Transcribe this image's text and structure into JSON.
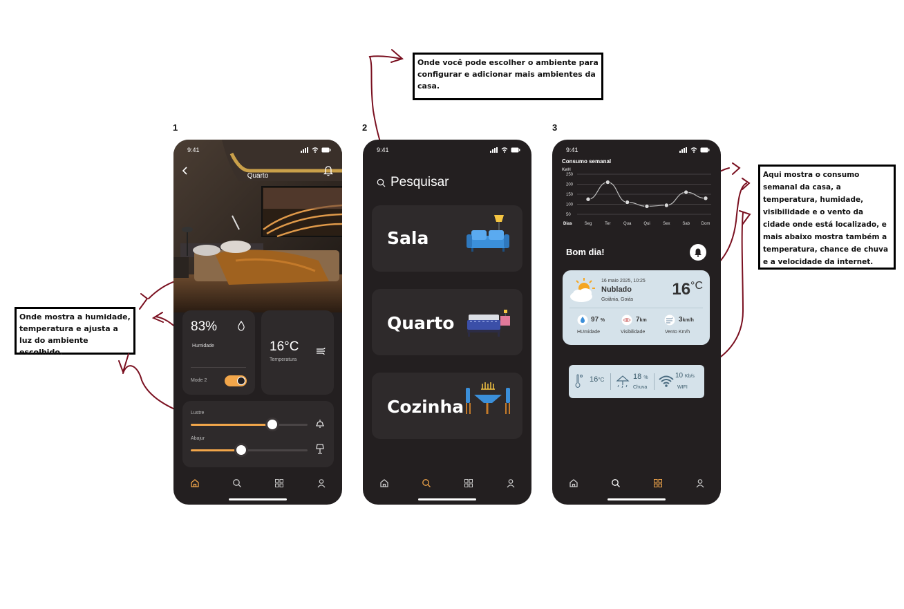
{
  "labels": {
    "p1": "1",
    "p2": "2",
    "p3": "3"
  },
  "notes": {
    "top": "Onde você pode escolher o ambiente para configurar e adicionar mais ambientes da casa.",
    "left": "Onde mostra a humidade, temperatura e ajusta a luz do ambiente escolhido.",
    "right": "Aqui mostra o consumo semanal da casa, a temperatura, humidade, visibilidade e o vento da cidade onde está localizado, e mais abaixo mostra também a temperatura, chance de chuva e a velocidade da internet."
  },
  "status": {
    "time": "9:41"
  },
  "screen1": {
    "title": "Quarto",
    "humidity": {
      "value": "83%",
      "label": "Humidade"
    },
    "temperature": {
      "value": "16°C",
      "label": "Temperatura"
    },
    "mode": {
      "label": "Mode 2",
      "on": true
    },
    "sliders": [
      {
        "label": "Lustre",
        "level": 0.7
      },
      {
        "label": "Abajur",
        "level": 0.43
      }
    ],
    "accent": "#f2a64a"
  },
  "screen2": {
    "search_placeholder": "Pesquisar",
    "rooms": [
      {
        "name": "Sala",
        "icon": "sofa-icon"
      },
      {
        "name": "Quarto",
        "icon": "bed-icon"
      },
      {
        "name": "Cozinha",
        "icon": "dining-table-icon"
      }
    ]
  },
  "screen3": {
    "chart_title": "Consumo semanal",
    "greeting": "Bom dia!",
    "weather": {
      "datetime": "16 maio 2025, 10:25",
      "condition": "Nublado",
      "location": "Goiânia, Goiás",
      "temp": "16",
      "temp_unit": "°C",
      "stats": [
        {
          "value": "97",
          "unit": "%",
          "label": "HUmidade",
          "icon": "drop-icon"
        },
        {
          "value": "7",
          "unit": "km",
          "label": "Visibilidade",
          "icon": "eye-icon"
        },
        {
          "value": "3",
          "unit": "km/h",
          "label": "Vento Km/h",
          "icon": "wind-icon"
        }
      ]
    },
    "mini": {
      "temp_value": "16",
      "temp_unit": "°C",
      "rain_value": "18",
      "rain_unit": "%",
      "rain_label": "Chuva",
      "wifi_value": "10",
      "wifi_unit": "Kb/s",
      "wifi_label": "WIFI"
    }
  },
  "chart_data": {
    "type": "line",
    "title": "Consumo semanal",
    "ylabel": "KwH",
    "xlabel": "Dias",
    "categories": [
      "Seg",
      "Ter",
      "Qua",
      "Qui",
      "Sex",
      "Sab",
      "Dom"
    ],
    "yticks": [
      250,
      200,
      150,
      100,
      50
    ],
    "ylim": [
      50,
      250
    ],
    "series": [
      {
        "values": [
          125,
          210,
          110,
          90,
          95,
          160,
          130
        ]
      }
    ],
    "grid": true
  }
}
